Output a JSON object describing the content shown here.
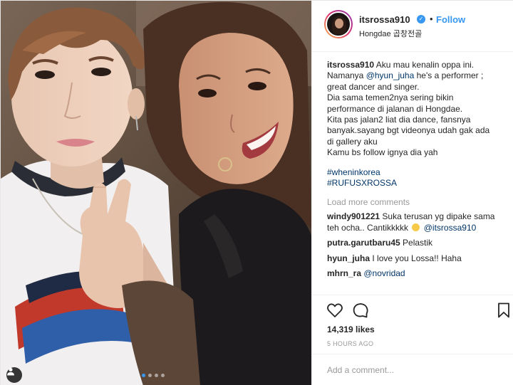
{
  "post": {
    "username": "itsrossa910",
    "follow_label": "Follow",
    "location": "Hongdae 곱창전골",
    "caption": {
      "lines": [
        "Namanya",
        "he's a performer ;",
        "great dancer and singer.",
        "Dia sama temen2nya sering bikin",
        "performance di jalanan di Hongdae.",
        "Kita pas jalan2 liat dia dance, fansnya",
        "banyak.sayang bgt videonya udah gak ada",
        "di gallery aku",
        "Kamu bs follow ignya dia yah"
      ],
      "first_line": "Aku mau kenalin oppa ini.",
      "mention": "@hyun_juha",
      "hashtags": [
        "#wheninkorea",
        "#RUFUSXROSSA"
      ]
    },
    "load_more_label": "Load more comments",
    "comments": [
      {
        "user": "windy901221",
        "text": "Suka terusan yg dipake sama teh ocha.. Cantikkkkk",
        "mention": "@itsrossa910"
      },
      {
        "user": "putra.garutbaru45",
        "text": "Pelastik"
      },
      {
        "user": "hyun_juha",
        "text": "I love you Lossa!! Haha"
      },
      {
        "user": "mhrn_ra",
        "mention": "@novridad"
      }
    ],
    "likes": "14,319 likes",
    "time": "5 HOURS AGO",
    "add_comment_placeholder": "Add a comment..."
  },
  "icons": {
    "like": "heart-icon",
    "comment": "comment-icon",
    "save": "bookmark-icon",
    "verified": "verified-badge-icon",
    "tag": "user-tag-icon"
  },
  "colors": {
    "accent": "#3897f0",
    "text": "#262626",
    "muted": "#999999",
    "link": "#003569"
  },
  "carousel": {
    "count": 4,
    "active": 1
  }
}
